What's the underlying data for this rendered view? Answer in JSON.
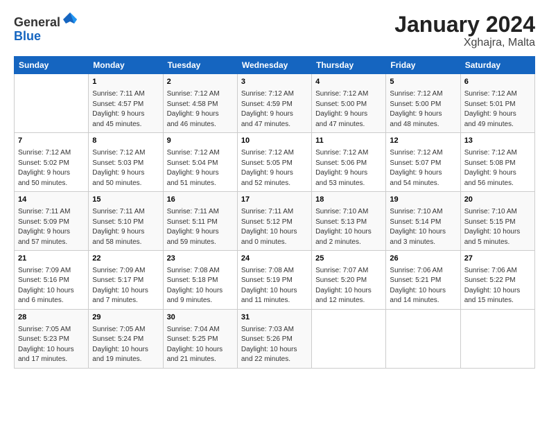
{
  "logo": {
    "general": "General",
    "blue": "Blue"
  },
  "title": "January 2024",
  "subtitle": "Xghajra, Malta",
  "days_header": [
    "Sunday",
    "Monday",
    "Tuesday",
    "Wednesday",
    "Thursday",
    "Friday",
    "Saturday"
  ],
  "weeks": [
    [
      {
        "day": "",
        "info": ""
      },
      {
        "day": "1",
        "info": "Sunrise: 7:11 AM\nSunset: 4:57 PM\nDaylight: 9 hours\nand 45 minutes."
      },
      {
        "day": "2",
        "info": "Sunrise: 7:12 AM\nSunset: 4:58 PM\nDaylight: 9 hours\nand 46 minutes."
      },
      {
        "day": "3",
        "info": "Sunrise: 7:12 AM\nSunset: 4:59 PM\nDaylight: 9 hours\nand 47 minutes."
      },
      {
        "day": "4",
        "info": "Sunrise: 7:12 AM\nSunset: 5:00 PM\nDaylight: 9 hours\nand 47 minutes."
      },
      {
        "day": "5",
        "info": "Sunrise: 7:12 AM\nSunset: 5:00 PM\nDaylight: 9 hours\nand 48 minutes."
      },
      {
        "day": "6",
        "info": "Sunrise: 7:12 AM\nSunset: 5:01 PM\nDaylight: 9 hours\nand 49 minutes."
      }
    ],
    [
      {
        "day": "7",
        "info": "Sunrise: 7:12 AM\nSunset: 5:02 PM\nDaylight: 9 hours\nand 50 minutes."
      },
      {
        "day": "8",
        "info": "Sunrise: 7:12 AM\nSunset: 5:03 PM\nDaylight: 9 hours\nand 50 minutes."
      },
      {
        "day": "9",
        "info": "Sunrise: 7:12 AM\nSunset: 5:04 PM\nDaylight: 9 hours\nand 51 minutes."
      },
      {
        "day": "10",
        "info": "Sunrise: 7:12 AM\nSunset: 5:05 PM\nDaylight: 9 hours\nand 52 minutes."
      },
      {
        "day": "11",
        "info": "Sunrise: 7:12 AM\nSunset: 5:06 PM\nDaylight: 9 hours\nand 53 minutes."
      },
      {
        "day": "12",
        "info": "Sunrise: 7:12 AM\nSunset: 5:07 PM\nDaylight: 9 hours\nand 54 minutes."
      },
      {
        "day": "13",
        "info": "Sunrise: 7:12 AM\nSunset: 5:08 PM\nDaylight: 9 hours\nand 56 minutes."
      }
    ],
    [
      {
        "day": "14",
        "info": "Sunrise: 7:11 AM\nSunset: 5:09 PM\nDaylight: 9 hours\nand 57 minutes."
      },
      {
        "day": "15",
        "info": "Sunrise: 7:11 AM\nSunset: 5:10 PM\nDaylight: 9 hours\nand 58 minutes."
      },
      {
        "day": "16",
        "info": "Sunrise: 7:11 AM\nSunset: 5:11 PM\nDaylight: 9 hours\nand 59 minutes."
      },
      {
        "day": "17",
        "info": "Sunrise: 7:11 AM\nSunset: 5:12 PM\nDaylight: 10 hours\nand 0 minutes."
      },
      {
        "day": "18",
        "info": "Sunrise: 7:10 AM\nSunset: 5:13 PM\nDaylight: 10 hours\nand 2 minutes."
      },
      {
        "day": "19",
        "info": "Sunrise: 7:10 AM\nSunset: 5:14 PM\nDaylight: 10 hours\nand 3 minutes."
      },
      {
        "day": "20",
        "info": "Sunrise: 7:10 AM\nSunset: 5:15 PM\nDaylight: 10 hours\nand 5 minutes."
      }
    ],
    [
      {
        "day": "21",
        "info": "Sunrise: 7:09 AM\nSunset: 5:16 PM\nDaylight: 10 hours\nand 6 minutes."
      },
      {
        "day": "22",
        "info": "Sunrise: 7:09 AM\nSunset: 5:17 PM\nDaylight: 10 hours\nand 7 minutes."
      },
      {
        "day": "23",
        "info": "Sunrise: 7:08 AM\nSunset: 5:18 PM\nDaylight: 10 hours\nand 9 minutes."
      },
      {
        "day": "24",
        "info": "Sunrise: 7:08 AM\nSunset: 5:19 PM\nDaylight: 10 hours\nand 11 minutes."
      },
      {
        "day": "25",
        "info": "Sunrise: 7:07 AM\nSunset: 5:20 PM\nDaylight: 10 hours\nand 12 minutes."
      },
      {
        "day": "26",
        "info": "Sunrise: 7:06 AM\nSunset: 5:21 PM\nDaylight: 10 hours\nand 14 minutes."
      },
      {
        "day": "27",
        "info": "Sunrise: 7:06 AM\nSunset: 5:22 PM\nDaylight: 10 hours\nand 15 minutes."
      }
    ],
    [
      {
        "day": "28",
        "info": "Sunrise: 7:05 AM\nSunset: 5:23 PM\nDaylight: 10 hours\nand 17 minutes."
      },
      {
        "day": "29",
        "info": "Sunrise: 7:05 AM\nSunset: 5:24 PM\nDaylight: 10 hours\nand 19 minutes."
      },
      {
        "day": "30",
        "info": "Sunrise: 7:04 AM\nSunset: 5:25 PM\nDaylight: 10 hours\nand 21 minutes."
      },
      {
        "day": "31",
        "info": "Sunrise: 7:03 AM\nSunset: 5:26 PM\nDaylight: 10 hours\nand 22 minutes."
      },
      {
        "day": "",
        "info": ""
      },
      {
        "day": "",
        "info": ""
      },
      {
        "day": "",
        "info": ""
      }
    ]
  ]
}
